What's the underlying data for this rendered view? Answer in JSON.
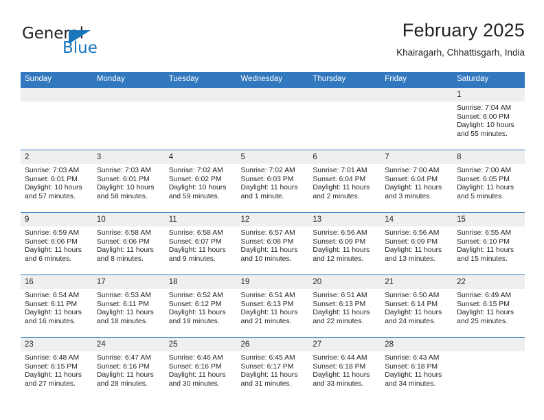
{
  "brand": {
    "name_part1": "General",
    "name_part2": "Blue",
    "triangle_color": "#1b75bb"
  },
  "header": {
    "title": "February 2025",
    "subtitle": "Khairagarh, Chhattisgarh, India"
  },
  "theme": {
    "header_blue": "#3178be",
    "daynum_gray": "#efefef",
    "text": "#231f20"
  },
  "weekday_headers": [
    "Sunday",
    "Monday",
    "Tuesday",
    "Wednesday",
    "Thursday",
    "Friday",
    "Saturday"
  ],
  "weeks": [
    [
      {
        "day": "",
        "blank": true,
        "sunrise": "",
        "sunset": "",
        "daylight1": "",
        "daylight2": ""
      },
      {
        "day": "",
        "blank": true,
        "sunrise": "",
        "sunset": "",
        "daylight1": "",
        "daylight2": ""
      },
      {
        "day": "",
        "blank": true,
        "sunrise": "",
        "sunset": "",
        "daylight1": "",
        "daylight2": ""
      },
      {
        "day": "",
        "blank": true,
        "sunrise": "",
        "sunset": "",
        "daylight1": "",
        "daylight2": ""
      },
      {
        "day": "",
        "blank": true,
        "sunrise": "",
        "sunset": "",
        "daylight1": "",
        "daylight2": ""
      },
      {
        "day": "",
        "blank": true,
        "sunrise": "",
        "sunset": "",
        "daylight1": "",
        "daylight2": ""
      },
      {
        "day": "1",
        "sunrise": "Sunrise: 7:04 AM",
        "sunset": "Sunset: 6:00 PM",
        "daylight1": "Daylight: 10 hours",
        "daylight2": "and 55 minutes."
      }
    ],
    [
      {
        "day": "2",
        "sunrise": "Sunrise: 7:03 AM",
        "sunset": "Sunset: 6:01 PM",
        "daylight1": "Daylight: 10 hours",
        "daylight2": "and 57 minutes."
      },
      {
        "day": "3",
        "sunrise": "Sunrise: 7:03 AM",
        "sunset": "Sunset: 6:01 PM",
        "daylight1": "Daylight: 10 hours",
        "daylight2": "and 58 minutes."
      },
      {
        "day": "4",
        "sunrise": "Sunrise: 7:02 AM",
        "sunset": "Sunset: 6:02 PM",
        "daylight1": "Daylight: 10 hours",
        "daylight2": "and 59 minutes."
      },
      {
        "day": "5",
        "sunrise": "Sunrise: 7:02 AM",
        "sunset": "Sunset: 6:03 PM",
        "daylight1": "Daylight: 11 hours",
        "daylight2": "and 1 minute."
      },
      {
        "day": "6",
        "sunrise": "Sunrise: 7:01 AM",
        "sunset": "Sunset: 6:04 PM",
        "daylight1": "Daylight: 11 hours",
        "daylight2": "and 2 minutes."
      },
      {
        "day": "7",
        "sunrise": "Sunrise: 7:00 AM",
        "sunset": "Sunset: 6:04 PM",
        "daylight1": "Daylight: 11 hours",
        "daylight2": "and 3 minutes."
      },
      {
        "day": "8",
        "sunrise": "Sunrise: 7:00 AM",
        "sunset": "Sunset: 6:05 PM",
        "daylight1": "Daylight: 11 hours",
        "daylight2": "and 5 minutes."
      }
    ],
    [
      {
        "day": "9",
        "sunrise": "Sunrise: 6:59 AM",
        "sunset": "Sunset: 6:06 PM",
        "daylight1": "Daylight: 11 hours",
        "daylight2": "and 6 minutes."
      },
      {
        "day": "10",
        "sunrise": "Sunrise: 6:58 AM",
        "sunset": "Sunset: 6:06 PM",
        "daylight1": "Daylight: 11 hours",
        "daylight2": "and 8 minutes."
      },
      {
        "day": "11",
        "sunrise": "Sunrise: 6:58 AM",
        "sunset": "Sunset: 6:07 PM",
        "daylight1": "Daylight: 11 hours",
        "daylight2": "and 9 minutes."
      },
      {
        "day": "12",
        "sunrise": "Sunrise: 6:57 AM",
        "sunset": "Sunset: 6:08 PM",
        "daylight1": "Daylight: 11 hours",
        "daylight2": "and 10 minutes."
      },
      {
        "day": "13",
        "sunrise": "Sunrise: 6:56 AM",
        "sunset": "Sunset: 6:09 PM",
        "daylight1": "Daylight: 11 hours",
        "daylight2": "and 12 minutes."
      },
      {
        "day": "14",
        "sunrise": "Sunrise: 6:56 AM",
        "sunset": "Sunset: 6:09 PM",
        "daylight1": "Daylight: 11 hours",
        "daylight2": "and 13 minutes."
      },
      {
        "day": "15",
        "sunrise": "Sunrise: 6:55 AM",
        "sunset": "Sunset: 6:10 PM",
        "daylight1": "Daylight: 11 hours",
        "daylight2": "and 15 minutes."
      }
    ],
    [
      {
        "day": "16",
        "sunrise": "Sunrise: 6:54 AM",
        "sunset": "Sunset: 6:11 PM",
        "daylight1": "Daylight: 11 hours",
        "daylight2": "and 16 minutes."
      },
      {
        "day": "17",
        "sunrise": "Sunrise: 6:53 AM",
        "sunset": "Sunset: 6:11 PM",
        "daylight1": "Daylight: 11 hours",
        "daylight2": "and 18 minutes."
      },
      {
        "day": "18",
        "sunrise": "Sunrise: 6:52 AM",
        "sunset": "Sunset: 6:12 PM",
        "daylight1": "Daylight: 11 hours",
        "daylight2": "and 19 minutes."
      },
      {
        "day": "19",
        "sunrise": "Sunrise: 6:51 AM",
        "sunset": "Sunset: 6:13 PM",
        "daylight1": "Daylight: 11 hours",
        "daylight2": "and 21 minutes."
      },
      {
        "day": "20",
        "sunrise": "Sunrise: 6:51 AM",
        "sunset": "Sunset: 6:13 PM",
        "daylight1": "Daylight: 11 hours",
        "daylight2": "and 22 minutes."
      },
      {
        "day": "21",
        "sunrise": "Sunrise: 6:50 AM",
        "sunset": "Sunset: 6:14 PM",
        "daylight1": "Daylight: 11 hours",
        "daylight2": "and 24 minutes."
      },
      {
        "day": "22",
        "sunrise": "Sunrise: 6:49 AM",
        "sunset": "Sunset: 6:15 PM",
        "daylight1": "Daylight: 11 hours",
        "daylight2": "and 25 minutes."
      }
    ],
    [
      {
        "day": "23",
        "sunrise": "Sunrise: 6:48 AM",
        "sunset": "Sunset: 6:15 PM",
        "daylight1": "Daylight: 11 hours",
        "daylight2": "and 27 minutes."
      },
      {
        "day": "24",
        "sunrise": "Sunrise: 6:47 AM",
        "sunset": "Sunset: 6:16 PM",
        "daylight1": "Daylight: 11 hours",
        "daylight2": "and 28 minutes."
      },
      {
        "day": "25",
        "sunrise": "Sunrise: 6:46 AM",
        "sunset": "Sunset: 6:16 PM",
        "daylight1": "Daylight: 11 hours",
        "daylight2": "and 30 minutes."
      },
      {
        "day": "26",
        "sunrise": "Sunrise: 6:45 AM",
        "sunset": "Sunset: 6:17 PM",
        "daylight1": "Daylight: 11 hours",
        "daylight2": "and 31 minutes."
      },
      {
        "day": "27",
        "sunrise": "Sunrise: 6:44 AM",
        "sunset": "Sunset: 6:18 PM",
        "daylight1": "Daylight: 11 hours",
        "daylight2": "and 33 minutes."
      },
      {
        "day": "28",
        "sunrise": "Sunrise: 6:43 AM",
        "sunset": "Sunset: 6:18 PM",
        "daylight1": "Daylight: 11 hours",
        "daylight2": "and 34 minutes."
      },
      {
        "day": "",
        "blank": true,
        "sunrise": "",
        "sunset": "",
        "daylight1": "",
        "daylight2": ""
      }
    ]
  ]
}
